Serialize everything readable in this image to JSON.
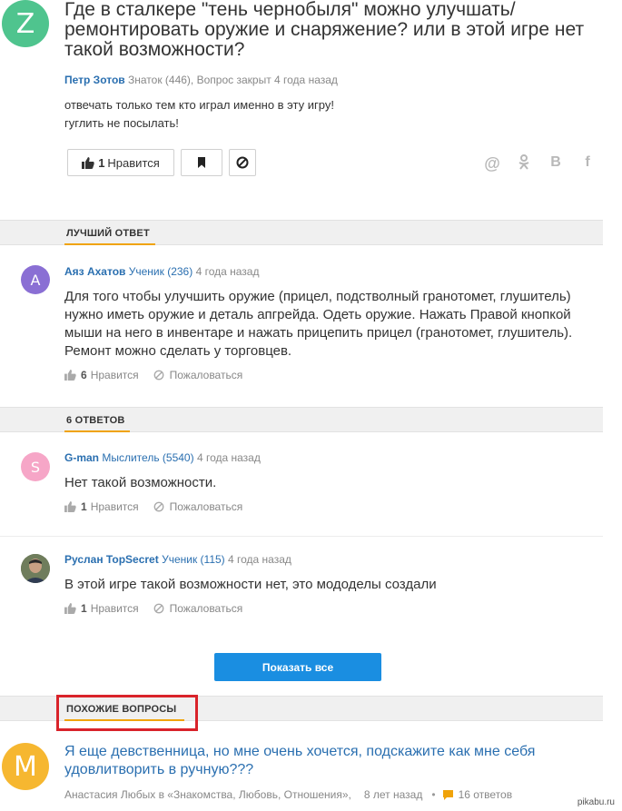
{
  "question": {
    "avatar_letter": "Z",
    "title": "Где в сталкере \"тень чернобыля\" можно улучшать/ ремонтировать оружие и снаряжение? или в этой игре нет такой возможности?",
    "author": "Петр Зотов",
    "rank": "Знаток (446),",
    "status": "Вопрос закрыт 4 года назад",
    "body_line1": "отвечать только тем кто играл именно в эту игру!",
    "body_line2": "гуглить не посылать!",
    "like_count": "1",
    "like_label": "Нравится",
    "share_icons": [
      "@",
      "ok",
      "B",
      "f"
    ]
  },
  "best_answer": {
    "section_label": "ЛУЧШИЙ ОТВЕТ",
    "avatar_letter": "A",
    "author": "Аяз Ахатов",
    "rank": "Ученик (236)",
    "time": "4 года назад",
    "text": "Для того чтобы улучшить оружие (прицел, подстволный гранотомет, глушитель) нужно иметь оружие и деталь апгрейда. Одеть оружие. Нажать Правой кнопкой мыши на него в инвентаре и нажать прицепить прицел (гранотомет, глушитель). Ремонт можно сделать у торговцев.",
    "like_count": "6",
    "like_label": "Нравится",
    "report_label": "Пожаловаться"
  },
  "answers_section": {
    "section_label": "6 ОТВЕТОВ",
    "answers": [
      {
        "avatar_letter": "S",
        "author": "G-man",
        "rank": "Мыслитель (5540)",
        "time": "4 года назад",
        "text": "Нет такой возможности.",
        "like_count": "1",
        "like_label": "Нравится",
        "report_label": "Пожаловаться"
      },
      {
        "avatar_letter": "",
        "author": "Руслан TopSecret",
        "rank": "Ученик (115)",
        "time": "4 года назад",
        "text": "В этой игре такой возможности нет, это мододелы создали",
        "like_count": "1",
        "like_label": "Нравится",
        "report_label": "Пожаловаться"
      }
    ],
    "show_all_label": "Показать все"
  },
  "similar": {
    "section_label": "ПОХОЖИЕ ВОПРОСЫ",
    "avatar_letter": "M",
    "title": "Я еще девственница, но мне очень хочется, подскажите как мне себя удовлитворить в ручную???",
    "author_category": "Анастасия Любых в «Знакомства, Любовь, Отношения»,",
    "time": "8 лет назад",
    "answers_count": "16 ответов"
  },
  "watermark": "pikabu.ru",
  "colors": {
    "accent_link": "#2a6fb0",
    "button_blue": "#1a8ee1",
    "underline_orange": "#f0a30a",
    "highlight_red": "#d9232a",
    "avatar_z": "#4fc48e",
    "avatar_a": "#8a6fd4",
    "avatar_s": "#f6a6c7",
    "avatar_m": "#f6b730"
  }
}
